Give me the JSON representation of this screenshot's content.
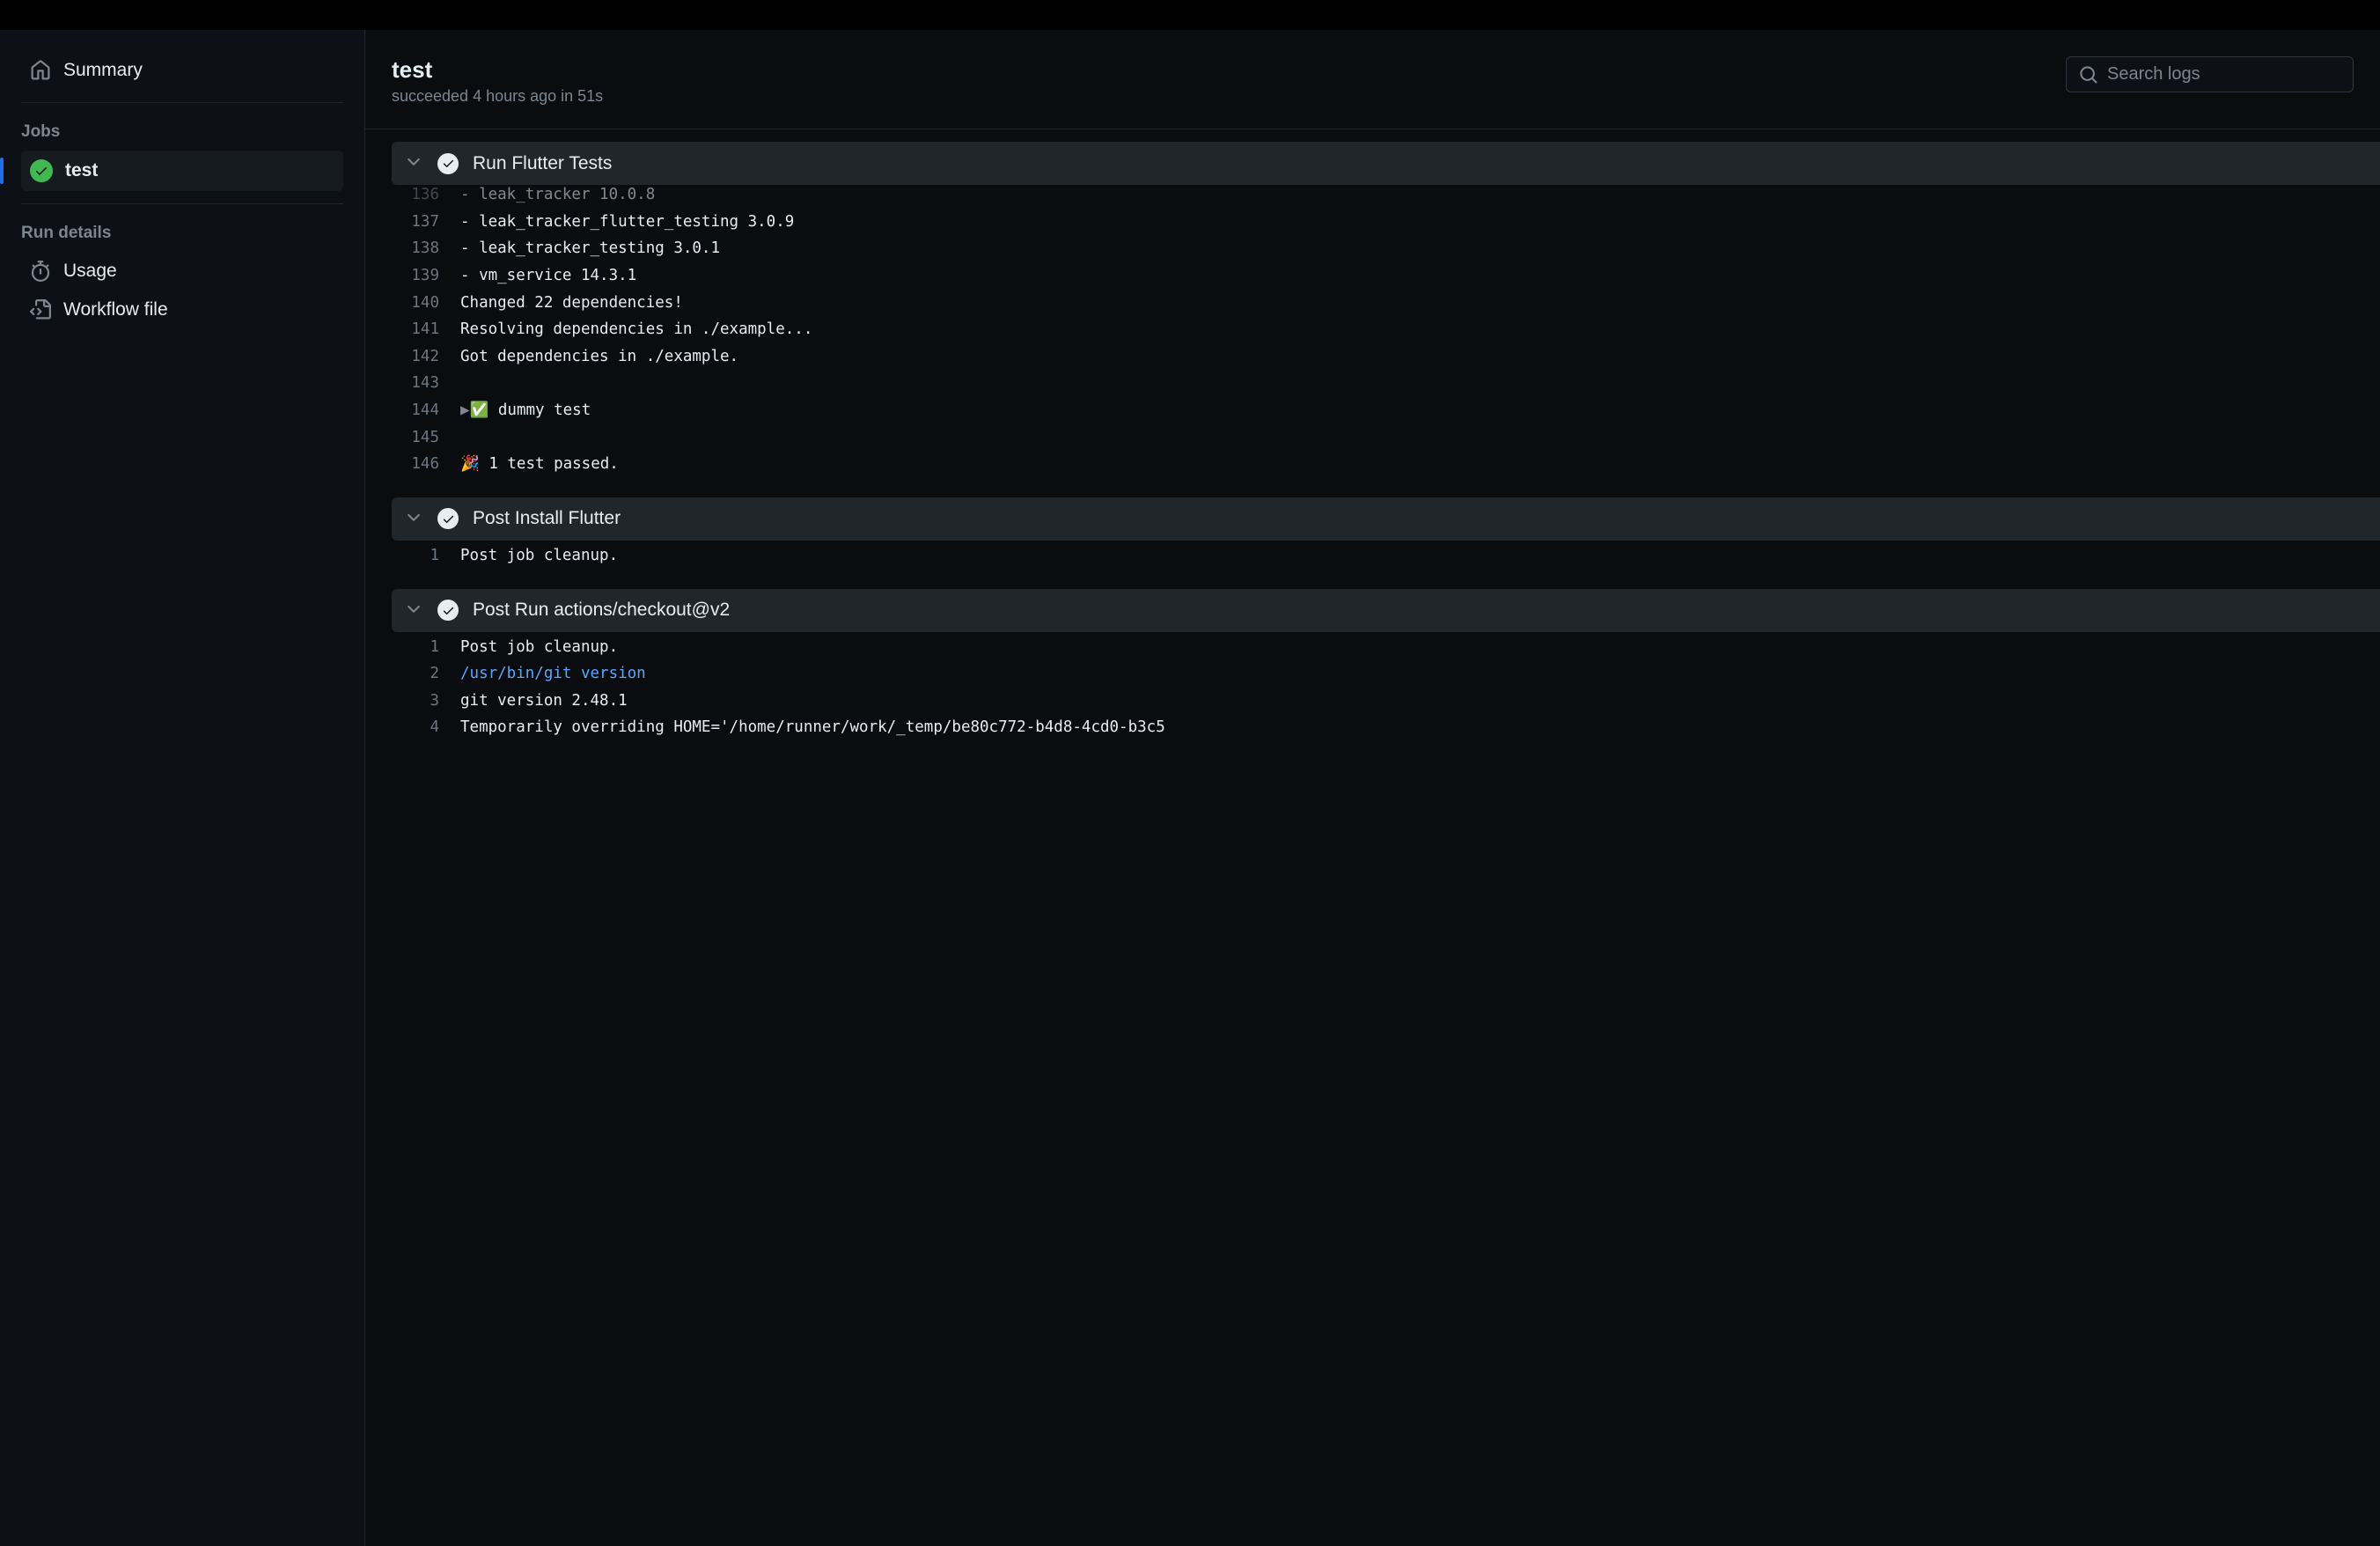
{
  "sidebar": {
    "summary_label": "Summary",
    "jobs_label": "Jobs",
    "jobs": [
      {
        "label": "test",
        "status": "success",
        "selected": true
      }
    ],
    "run_details_label": "Run details",
    "usage_label": "Usage",
    "workflow_file_label": "Workflow file"
  },
  "header": {
    "title": "test",
    "subtitle": "succeeded 4 hours ago in 51s"
  },
  "search": {
    "placeholder": "Search logs"
  },
  "steps": [
    {
      "title": "Run Flutter Tests",
      "status": "success",
      "expanded": true,
      "lines": [
        {
          "n": 136,
          "t": "- leak_tracker 10.0.8",
          "partial": true
        },
        {
          "n": 137,
          "t": "- leak_tracker_flutter_testing 3.0.9"
        },
        {
          "n": 138,
          "t": "- leak_tracker_testing 3.0.1"
        },
        {
          "n": 139,
          "t": "- vm_service 14.3.1"
        },
        {
          "n": 140,
          "t": "Changed 22 dependencies!"
        },
        {
          "n": 141,
          "t": "Resolving dependencies in ./example..."
        },
        {
          "n": 142,
          "t": "Got dependencies in ./example."
        },
        {
          "n": 143,
          "t": ""
        },
        {
          "n": 144,
          "t_pre": "▶",
          "t": "✅ dummy test"
        },
        {
          "n": 145,
          "t": ""
        },
        {
          "n": 146,
          "t": "🎉 1 test passed."
        }
      ]
    },
    {
      "title": "Post Install Flutter",
      "status": "success",
      "expanded": true,
      "lines": [
        {
          "n": 1,
          "t": "Post job cleanup."
        }
      ]
    },
    {
      "title": "Post Run actions/checkout@v2",
      "status": "success",
      "expanded": true,
      "lines": [
        {
          "n": 1,
          "t": "Post job cleanup."
        },
        {
          "n": 2,
          "t": "/usr/bin/git version",
          "cmd": true
        },
        {
          "n": 3,
          "t": "git version 2.48.1"
        },
        {
          "n": 4,
          "t": "Temporarily overriding HOME='/home/runner/work/_temp/be80c772-b4d8-4cd0-b3c5"
        }
      ]
    }
  ]
}
